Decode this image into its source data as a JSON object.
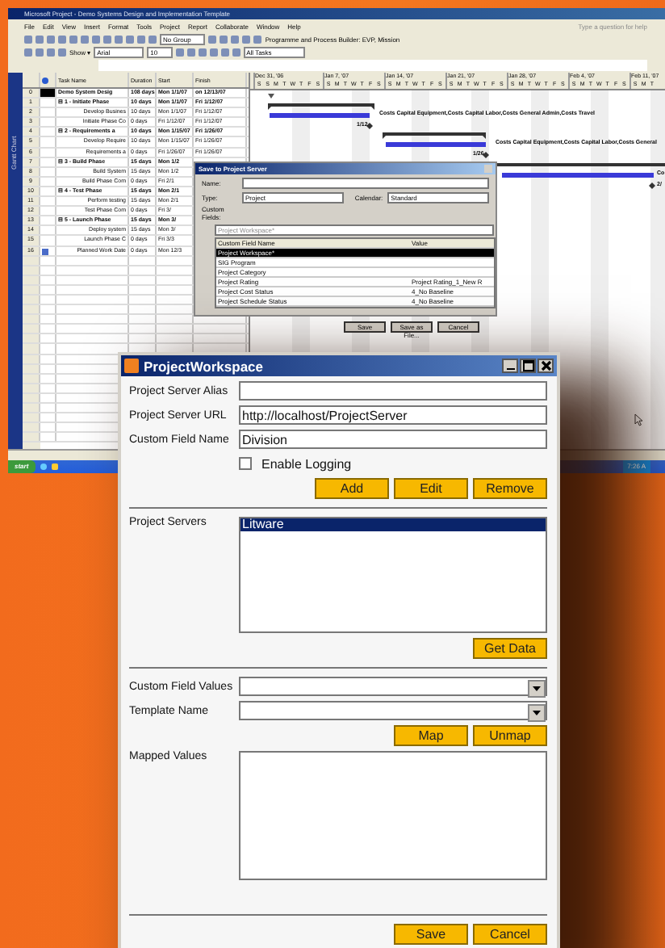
{
  "project_window": {
    "title": "Microsoft Project - Demo Systems Design and Implementation Template",
    "menu": [
      "File",
      "Edit",
      "View",
      "Insert",
      "Format",
      "Tools",
      "Project",
      "Report",
      "Collaborate",
      "Window",
      "Help"
    ],
    "help_placeholder": "Type a question for help",
    "group_select": "No Group",
    "process_label": "Programme and Process Builder: EVP, Mission",
    "show_button": "Show ▾",
    "font_select": "Arial",
    "size_select": "10",
    "filter_select": "All Tasks",
    "view_bar": "Gantt Chart",
    "columns": [
      "Task Name",
      "Duration",
      "Start",
      "Finish"
    ],
    "tasks": [
      {
        "id": "0",
        "name": "Demo System Desig",
        "duration": "108 days",
        "start": "Mon 1/1/07",
        "finish": "on 12/13/07",
        "summary": true
      },
      {
        "id": "1",
        "name": "⊟ 1 - Initiate Phase",
        "duration": "10 days",
        "start": "Mon 1/1/07",
        "finish": "Fri 1/12/07",
        "summary": true
      },
      {
        "id": "2",
        "name": "Develop Busines",
        "duration": "10 days",
        "start": "Mon 1/1/07",
        "finish": "Fri 1/12/07",
        "summary": false
      },
      {
        "id": "3",
        "name": "Initiate Phase Co",
        "duration": "0 days",
        "start": "Fri 1/12/07",
        "finish": "Fri 1/12/07",
        "summary": false
      },
      {
        "id": "4",
        "name": "⊟ 2 - Requirements a",
        "duration": "10 days",
        "start": "Mon 1/15/07",
        "finish": "Fri 1/26/07",
        "summary": true
      },
      {
        "id": "5",
        "name": "Develop Require",
        "duration": "10 days",
        "start": "Mon 1/15/07",
        "finish": "Fri 1/26/07",
        "summary": false
      },
      {
        "id": "6",
        "name": "Requirements a",
        "duration": "0 days",
        "start": "Fri 1/26/07",
        "finish": "Fri 1/26/07",
        "summary": false
      },
      {
        "id": "7",
        "name": "⊟ 3 - Build Phase",
        "duration": "15 days",
        "start": "Mon 1/2",
        "summary": true
      },
      {
        "id": "8",
        "name": "Build System",
        "duration": "15 days",
        "start": "Mon 1/2",
        "summary": false
      },
      {
        "id": "9",
        "name": "Build Phase Com",
        "duration": "0 days",
        "start": "Fri 2/1",
        "summary": false
      },
      {
        "id": "10",
        "name": "⊟ 4 - Test Phase",
        "duration": "15 days",
        "start": "Mon 2/1",
        "summary": true
      },
      {
        "id": "11",
        "name": "Perform testing",
        "duration": "15 days",
        "start": "Mon 2/1",
        "summary": false
      },
      {
        "id": "12",
        "name": "Test Phase Com",
        "duration": "0 days",
        "start": "Fri 3/",
        "summary": false
      },
      {
        "id": "13",
        "name": "⊟ 5 - Launch Phase",
        "duration": "15 days",
        "start": "Mon 3/",
        "summary": true
      },
      {
        "id": "14",
        "name": "Deploy system",
        "duration": "15 days",
        "start": "Mon 3/",
        "summary": false
      },
      {
        "id": "15",
        "name": "Launch Phase C",
        "duration": "0 days",
        "start": "Fri 3/3",
        "summary": false
      },
      {
        "id": "16",
        "name": "Planned Work Date",
        "duration": "0 days",
        "start": "Mon 12/3",
        "summary": false
      }
    ],
    "weeks": [
      {
        "label": "Dec 31, '06",
        "days": [
          "S",
          "S",
          "M",
          "T",
          "W",
          "T",
          "F",
          "S"
        ]
      },
      {
        "label": "Jan 7, '07",
        "days": [
          "S",
          "M",
          "T",
          "W",
          "T",
          "F",
          "S"
        ]
      },
      {
        "label": "Jan 14, '07",
        "days": [
          "S",
          "M",
          "T",
          "W",
          "T",
          "F",
          "S"
        ]
      },
      {
        "label": "Jan 21, '07",
        "days": [
          "S",
          "M",
          "T",
          "W",
          "T",
          "F",
          "S"
        ]
      },
      {
        "label": "Jan 28, '07",
        "days": [
          "S",
          "M",
          "T",
          "W",
          "T",
          "F",
          "S"
        ]
      },
      {
        "label": "Feb 4, '07",
        "days": [
          "S",
          "M",
          "T",
          "W",
          "T",
          "F",
          "S"
        ]
      },
      {
        "label": "Feb 11, '07",
        "days": [
          "S",
          "M",
          "T"
        ]
      }
    ],
    "bar_labels": [
      "Costs Capital Equipment,Costs Capital Labor,Costs General Admin,Costs Travel",
      "1/12",
      "Costs Capital Equipment,Costs Capital Labor,Costs General",
      "1/26",
      "Co",
      "2/"
    ],
    "taskbar": {
      "start": "start",
      "clock": "7:26 A"
    }
  },
  "save_dialog": {
    "title": "Save to Project Server",
    "name_label": "Name:",
    "type_label": "Type:",
    "type_value": "Project",
    "calendar_label": "Calendar:",
    "calendar_value": "Standard",
    "custom_fields_label": "Custom Fields:",
    "custom_fields_select": "Project Workspace*",
    "columns": [
      "Custom Field Name",
      "Value"
    ],
    "rows": [
      {
        "name": "Project Workspace*",
        "selected": true
      },
      {
        "name": "SIG Program",
        "selected": false
      },
      {
        "name": "Project Category",
        "selected": false
      },
      {
        "name": "Project Rating",
        "value": "Project Rating_1_New R",
        "selected": false
      },
      {
        "name": "Project Cost Status",
        "value": "4_No Baseline",
        "selected": false
      },
      {
        "name": "Project Schedule Status",
        "value": "4_No Baseline",
        "selected": false
      }
    ],
    "buttons": [
      "Save",
      "Save as File...",
      "Cancel"
    ]
  },
  "workspace": {
    "title": "ProjectWorkspace",
    "fields": [
      {
        "label": "Project Server Alias"
      },
      {
        "label": "Project Server URL",
        "value": "http://localhost/ProjectServer"
      },
      {
        "label": "Custom Field Name",
        "value": "Division"
      }
    ],
    "enable_logging": {
      "label": "Enable Logging",
      "checked": false
    },
    "server_buttons": [
      "Add",
      "Edit",
      "Remove"
    ],
    "servers_label": "Project Servers",
    "servers": [
      {
        "name": "Litware",
        "selected": true
      }
    ],
    "get_data": "Get Data",
    "combos": [
      {
        "label": "Custom Field Values"
      },
      {
        "label": "Template Name"
      }
    ],
    "map_buttons": [
      "Map",
      "Unmap"
    ],
    "mapped_label": "Mapped Values",
    "footer_buttons": [
      "Save",
      "Cancel"
    ]
  }
}
